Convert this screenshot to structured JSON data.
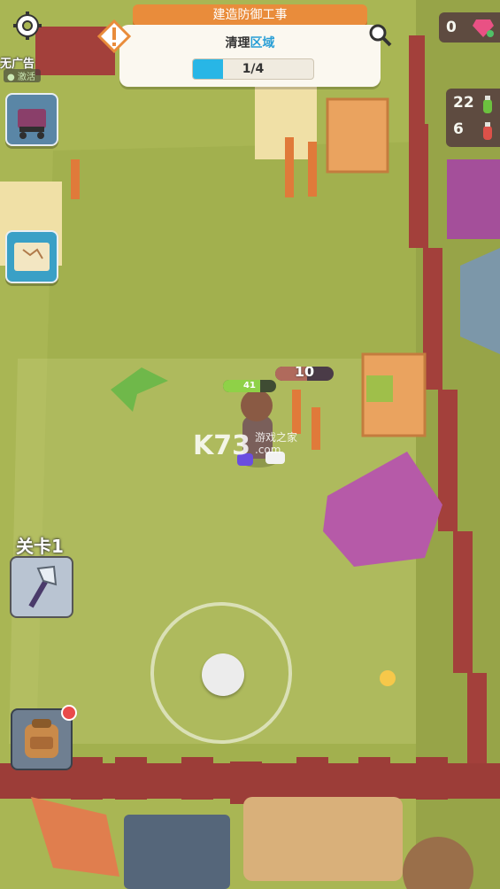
{
  "hud": {
    "settings_icon": "gear-icon",
    "quest_title": "建造防御工事",
    "task_prefix": "清理",
    "task_highlight": "区域",
    "progress_text": "1/4",
    "progress_fraction": 0.25,
    "gems": "0",
    "wood": "22",
    "stone": "6",
    "no_ads_label": "无广告",
    "no_ads_status": "激活",
    "level_label": "关卡1",
    "bag_has_notification": true
  },
  "player": {
    "hp": "41",
    "hp_fraction": 0.7
  },
  "target": {
    "hits_left": "10",
    "fill_fraction": 0.55
  },
  "watermark": {
    "main": "K73",
    "sub1": "游戏之家",
    "sub2": ".com"
  },
  "colors": {
    "accent_orange": "#e98c3b",
    "progress_blue": "#28b6e6",
    "grass": "#a9b654",
    "fence": "#a3403b"
  }
}
